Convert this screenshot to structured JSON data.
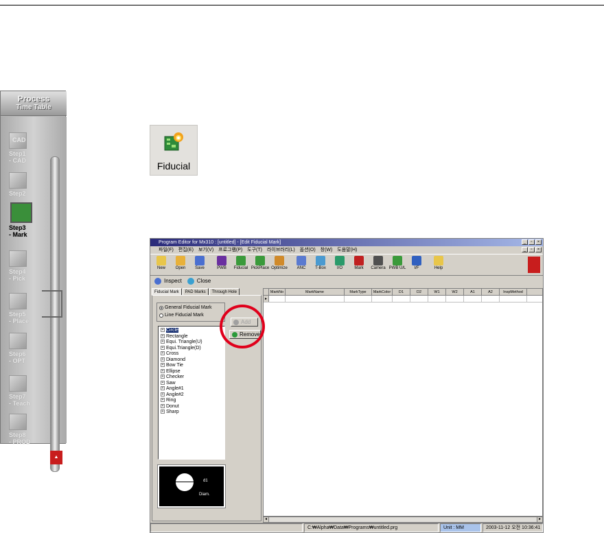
{
  "process_table": {
    "title_line1": "Process",
    "title_line2": "Time Table",
    "steps": [
      {
        "icon": "CAD",
        "label1": "Step1",
        "label2": "- CAD"
      },
      {
        "icon": "",
        "label1": "Step2",
        "label2": ""
      },
      {
        "icon": "",
        "label1": "Step3",
        "label2": "- Mark"
      },
      {
        "icon": "",
        "label1": "Step4",
        "label2": "- Pick"
      },
      {
        "icon": "",
        "label1": "Step5",
        "label2": "- Place"
      },
      {
        "icon": "",
        "label1": "Step6",
        "label2": "- OPT"
      },
      {
        "icon": "",
        "label1": "Step7",
        "label2": "- Teach"
      },
      {
        "icon": "",
        "label1": "Step8",
        "label2": "- PROD"
      }
    ],
    "active_step": 3
  },
  "fiducial_icon": {
    "caption": "Fiducial"
  },
  "editor": {
    "title": "Program Editor for Mx310 : [untitled] - [Edit Fiducial Mark]",
    "menu": [
      "파일(F)",
      "편집(E)",
      "보기(V)",
      "프로그램(P)",
      "도구(T)",
      "라이브러리(L)",
      "옵션(O)",
      "창(W)",
      "도움말(H)"
    ],
    "toolbar": [
      {
        "label": "New",
        "color": "#e8c64a"
      },
      {
        "label": "Open",
        "color": "#e8b13a"
      },
      {
        "label": "Save",
        "color": "#4a6fd0"
      },
      {
        "label": "PWB",
        "color": "#6a2fa0"
      },
      {
        "label": "Fiducial",
        "color": "#3a9a3a"
      },
      {
        "label": "PickPlace",
        "color": "#3a9a3a"
      },
      {
        "label": "Optimize",
        "color": "#d08a2a"
      },
      {
        "label": "ANC",
        "color": "#5a7ad0"
      },
      {
        "label": "T-Box",
        "color": "#4a9ad0"
      },
      {
        "label": "I/O",
        "color": "#2a9a6a"
      },
      {
        "label": "Mark",
        "color": "#c02020"
      },
      {
        "label": "Camera",
        "color": "#505050"
      },
      {
        "label": "PWB U/L",
        "color": "#3a9a3a"
      },
      {
        "label": "I/F",
        "color": "#3060c0"
      },
      {
        "label": "Help",
        "color": "#e8c64a"
      }
    ],
    "subbar": {
      "inspect": "Inspect",
      "close": "Close"
    },
    "tabs": [
      "Fiducial Mark",
      "PAD Marks",
      "Through Hole"
    ],
    "radio": {
      "general": "General Fiducial Mark",
      "line": "Line Fiducial Mark"
    },
    "tree": [
      "Circle",
      "Rectangle",
      "Equi. Triangle(U)",
      "Equi.Triangle(D)",
      "Cross",
      "Diamond",
      "Bow Tie",
      "Ellipse",
      "Checker",
      "Saw",
      "Angle#1",
      "Angle#2",
      "Ring",
      "Donut",
      "Sharp"
    ],
    "preview": {
      "d1": "d1",
      "diam": "Diam."
    },
    "buttons": {
      "add": "Add",
      "remove": "Remove"
    },
    "grid_headers": [
      "MarkNo",
      "MarkName",
      "MarkType",
      "MarkColor",
      "D1",
      "D2",
      "W1",
      "W2",
      "A1",
      "A2",
      "InspMethod"
    ],
    "status": {
      "path": "C:₩Alpha₩Data₩Programs₩untitled.prg",
      "unit": "Unit : MM",
      "datetime": "2003-11-12 오전 10:36:41"
    }
  }
}
